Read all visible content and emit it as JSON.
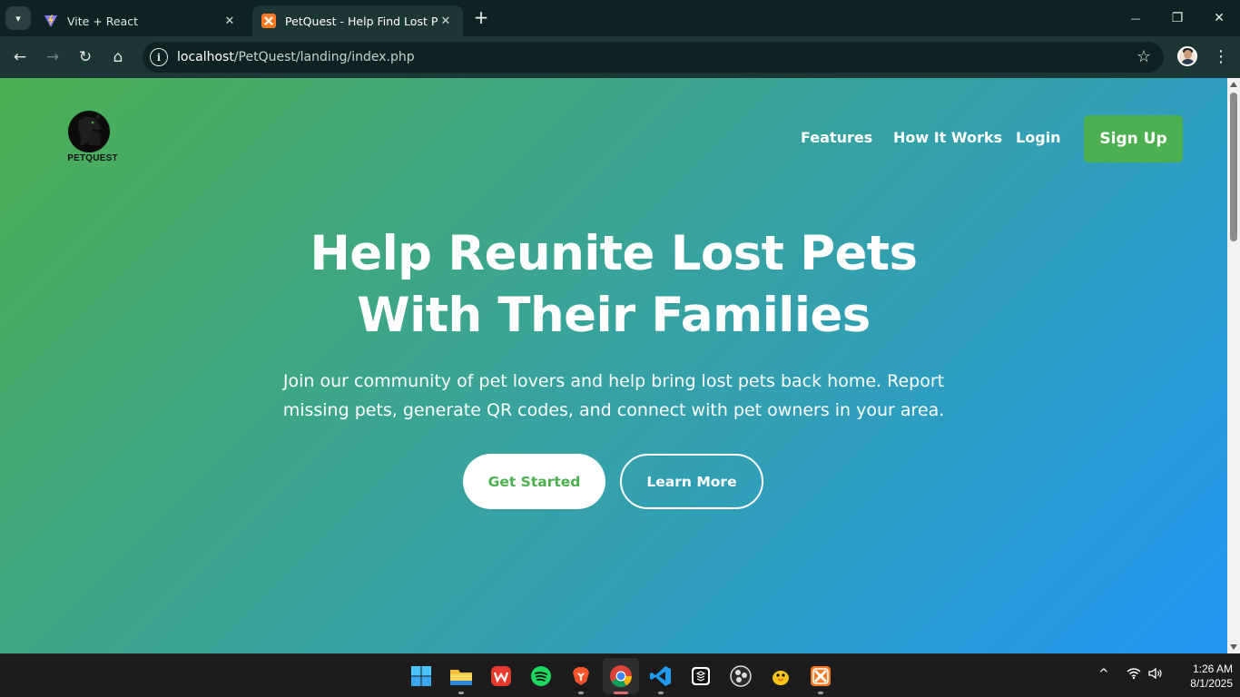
{
  "browser": {
    "tabs": [
      {
        "title": "Vite + React",
        "icon": "vite-icon",
        "active": false
      },
      {
        "title": "PetQuest - Help Find Lost Pets",
        "icon": "xampp-icon",
        "active": true
      }
    ],
    "tab_close_glyph": "✕",
    "new_tab_glyph": "+",
    "window_controls": {
      "minimize": "—",
      "restore": "❐",
      "close": "✕"
    },
    "nav": {
      "back": "←",
      "forward": "→",
      "reload": "↻",
      "home": "⌂"
    },
    "url_host": "localhost",
    "url_path": "/PetQuest/landing/index.php",
    "site_info_glyph": "i",
    "bookmark_glyph": "☆",
    "menu_glyph": "⋮"
  },
  "page": {
    "logo_text": "PETQUEST",
    "nav_links": [
      "Features",
      "How It Works",
      "Login"
    ],
    "signup_label": "Sign Up",
    "hero_title_line1": "Help Reunite Lost Pets",
    "hero_title_line2": "With Their Families",
    "hero_subtitle_line1": "Join our community of pet lovers and help bring lost pets back home. Report",
    "hero_subtitle_line2": "missing pets, generate QR codes, and connect with pet owners in your area.",
    "primary_cta": "Get Started",
    "secondary_cta": "Learn More",
    "colors": {
      "gradient_start": "#4caf50",
      "gradient_end": "#2196f3",
      "accent": "#4caf50"
    }
  },
  "taskbar": {
    "apps": [
      "windows-start-icon",
      "file-explorer-icon",
      "wps-office-icon",
      "spotify-icon",
      "brave-icon",
      "chrome-icon",
      "vscode-icon",
      "app-icon",
      "obs-icon",
      "duck-app-icon",
      "xampp-icon"
    ],
    "tray_chevron": "^",
    "time": "1:26 AM",
    "date": "8/1/2025"
  }
}
